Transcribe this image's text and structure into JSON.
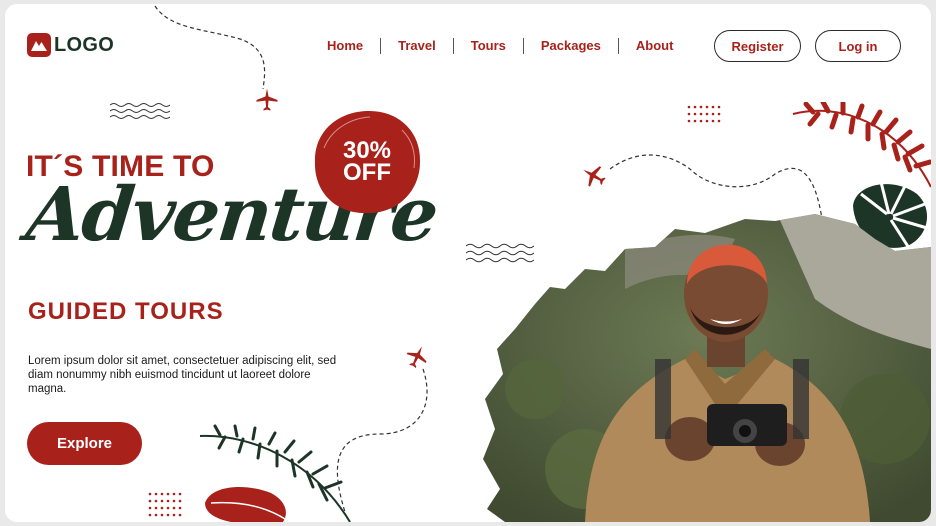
{
  "brand": {
    "logo_text": "LOGO"
  },
  "nav": {
    "items": [
      "Home",
      "Travel",
      "Tours",
      "Packages",
      "About"
    ]
  },
  "auth": {
    "register_label": "Register",
    "login_label": "Log in"
  },
  "hero": {
    "headline": "IT´S TIME TO",
    "script_title": "Adventure",
    "subhead": "GUIDED TOURS",
    "body": "Lorem ipsum dolor sit amet, consectetuer adipiscing elit, sed diam nonummy nibh euismod tincidunt ut laoreet dolore magna.",
    "cta_label": "Explore"
  },
  "promo": {
    "line1": "30%",
    "line2": "OFF"
  },
  "colors": {
    "accent": "#a8221b",
    "dark_green": "#1d3526",
    "background": "#ffffff"
  },
  "icons": [
    "logo-mountain-icon",
    "airplane-icon",
    "wave-lines-icon",
    "dot-grid-icon",
    "palm-leaf-icon",
    "monstera-leaf-icon"
  ]
}
